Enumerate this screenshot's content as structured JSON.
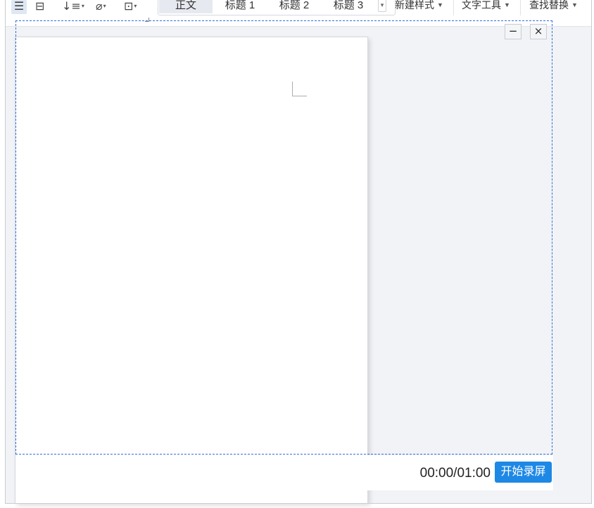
{
  "toolbar": {
    "icons": [
      "align-justify-icon",
      "distributed-align-icon",
      "line-spacing-icon",
      "shading-icon",
      "border-icon"
    ],
    "styles": [
      "正文",
      "标题 1",
      "标题 2",
      "标题 3"
    ],
    "selected_style": "正文",
    "new_style_label": "新建样式",
    "text_tools_label": "文字工具",
    "find_replace_label": "查找替换"
  },
  "recorder": {
    "minimize_label": "−",
    "close_label": "×",
    "timer": "00:00/01:00",
    "start_label": "开始录屏"
  },
  "colors": {
    "region_border": "#2f6fe0",
    "start_button": "#1e88e5",
    "workspace_bg": "#f1f3f6"
  }
}
